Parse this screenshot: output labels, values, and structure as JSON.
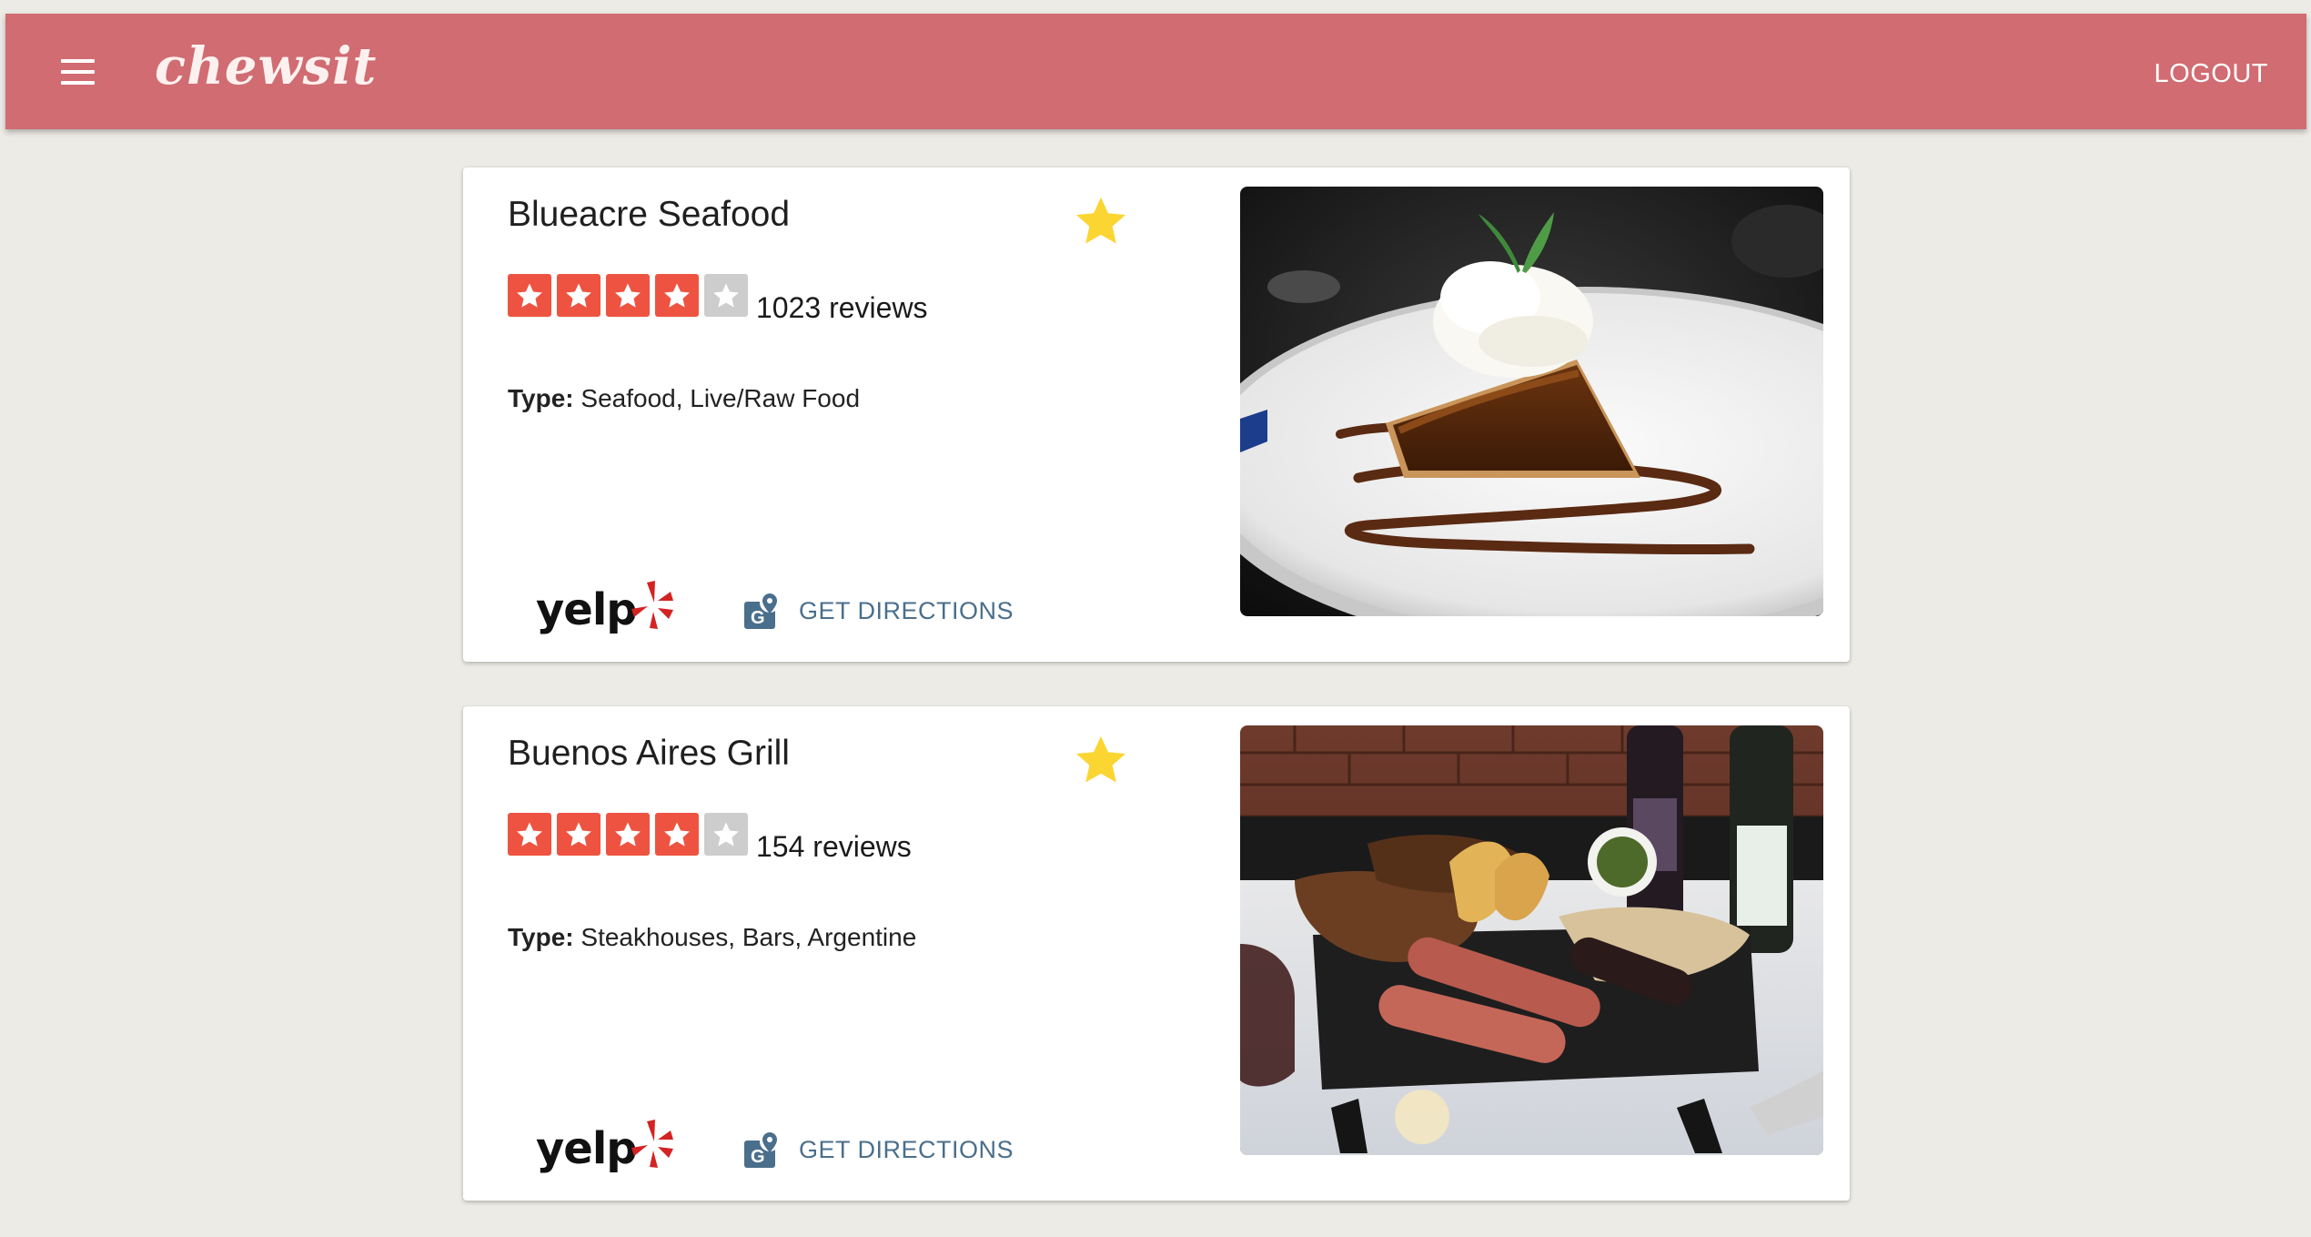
{
  "header": {
    "brand": "chewsit",
    "logout_label": "LOGOUT",
    "background_color": "#d06c72"
  },
  "restaurants": [
    {
      "name": "Blueacre Seafood",
      "rating": 4,
      "rating_max": 5,
      "reviews": "1023 reviews",
      "type_label": "Type:",
      "type_value": "Seafood, Live/Raw Food",
      "favorite": true,
      "yelp_text": "yelp",
      "directions_label": "GET DIRECTIONS",
      "photo": "pecan-pie-with-whipped-cream"
    },
    {
      "name": "Buenos Aires Grill",
      "rating": 4,
      "rating_max": 5,
      "reviews": "154 reviews",
      "type_label": "Type:",
      "type_value": "Steakhouses, Bars, Argentine",
      "favorite": true,
      "yelp_text": "yelp",
      "directions_label": "GET DIRECTIONS",
      "photo": "grilled-meat-platter-with-wine"
    }
  ],
  "colors": {
    "star_filled": "#ee5341",
    "star_empty": "#cdcdcd",
    "favorite_star": "#fbd531",
    "directions": "#4a6f8c",
    "yelp_burst": "#d32323"
  },
  "icons": {
    "menu": "hamburger-menu-icon",
    "favorite": "star-icon",
    "rating": "rating-star-icon",
    "yelp": "yelp-logo",
    "directions": "map-pin-icon"
  }
}
